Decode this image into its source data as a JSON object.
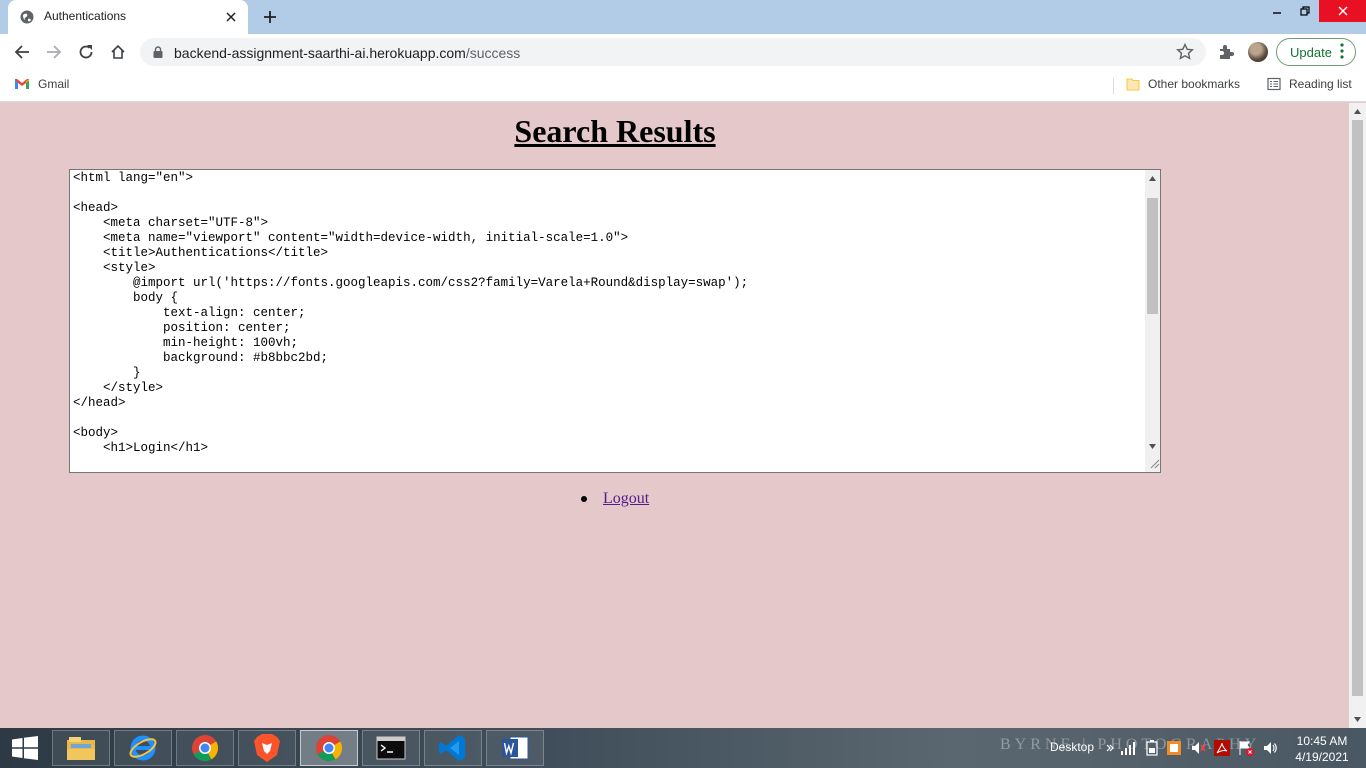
{
  "browser": {
    "tab": {
      "title": "Authentications"
    },
    "address": {
      "host": "backend-assignment-saarthi-ai.herokuapp.com",
      "path": "/success"
    },
    "update_label": "Update",
    "bookmarks": {
      "gmail": "Gmail",
      "other": "Other bookmarks",
      "reading_list": "Reading list"
    }
  },
  "page": {
    "title": "Search Results",
    "code": "<html lang=\"en\">\n\n<head>\n    <meta charset=\"UTF-8\">\n    <meta name=\"viewport\" content=\"width=device-width, initial-scale=1.0\">\n    <title>Authentications</title>\n    <style>\n        @import url('https://fonts.googleapis.com/css2?family=Varela+Round&display=swap');\n        body {\n            text-align: center;\n            position: center;\n            min-height: 100vh;\n            background: #b8bbc2bd;\n        }\n    </style>\n</head>\n\n<body>\n    <h1>Login</h1>",
    "links": [
      {
        "label": "Logout"
      }
    ]
  },
  "taskbar": {
    "apps": [
      "file-explorer-icon",
      "internet-explorer-icon",
      "chrome-icon",
      "brave-icon",
      "chrome-icon",
      "cmd-icon",
      "vscode-icon",
      "word-icon"
    ],
    "watermark": "BYRNE | PHOTOGRAPHY",
    "desktop_label": "Desktop",
    "time": "10:45 AM",
    "date": "4/19/2021"
  },
  "colors": {
    "page_background": "#e4c8ca",
    "tabstrip": "#b2cbe6",
    "link_visited": "#551a8b",
    "update_accent": "#137333"
  }
}
